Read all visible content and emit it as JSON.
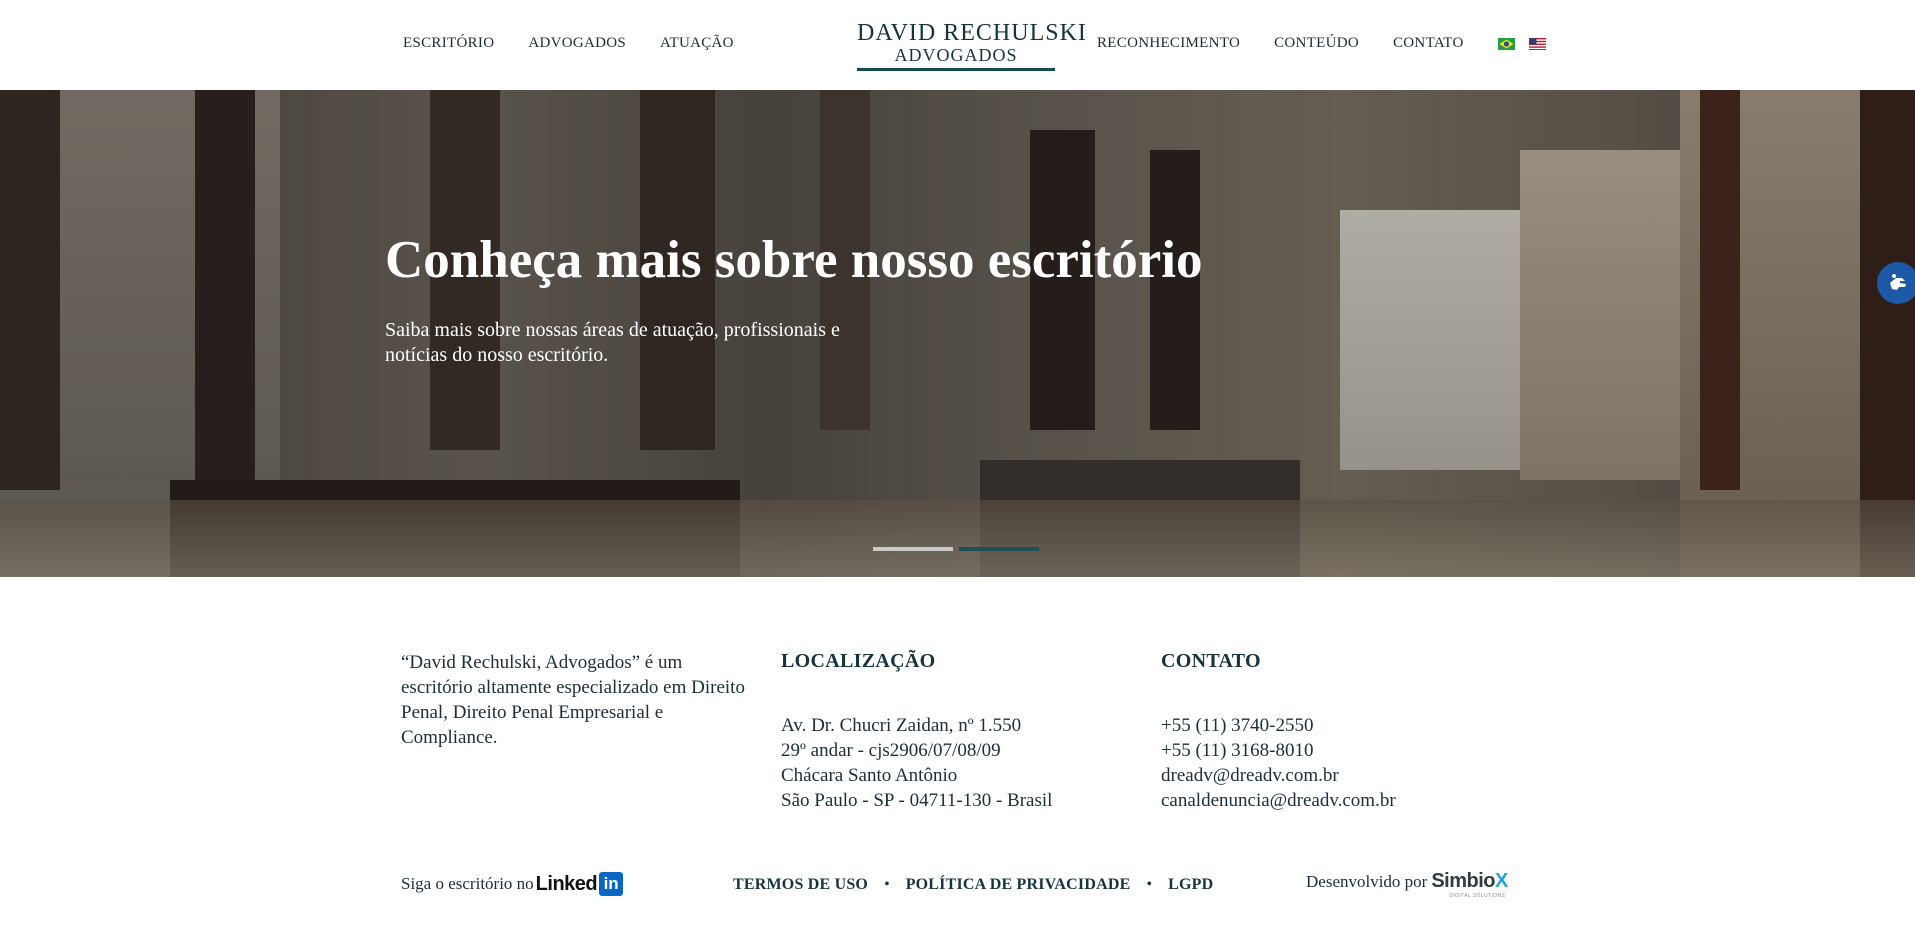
{
  "header": {
    "nav_left": [
      "ESCRITÓRIO",
      "ADVOGADOS",
      "ATUAÇÃO"
    ],
    "nav_right": [
      "RECONHECIMENTO",
      "CONTEÚDO",
      "CONTATO"
    ],
    "logo": {
      "line1": "DAVID RECHULSKI",
      "line2": "ADVOGADOS"
    },
    "flags": [
      "brazil-flag-icon",
      "usa-flag-icon"
    ]
  },
  "hero": {
    "title": "Conheça mais sobre nosso escritório",
    "subtitle": "Saiba mais sobre nossas áreas de atuação, profissionais e notícias do nosso escritório.",
    "slides": 2,
    "active_slide": 1
  },
  "footer": {
    "about": "“David Rechulski, Advogados” é um escritório altamente especializado em Direito Penal, Direito Penal Empresarial e Compliance.",
    "location": {
      "title": "LOCALIZAÇÃO",
      "lines": [
        "Av. Dr. Chucri Zaidan, nº 1.550",
        "29º andar - cjs2906/07/08/09",
        "Chácara Santo Antônio",
        "São Paulo - SP - 04711-130 - Brasil"
      ]
    },
    "contact": {
      "title": "CONTATO",
      "lines": [
        "+55 (11) 3740-2550",
        "+55 (11) 3168-8010",
        "dreadv@dreadv.com.br",
        "canaldenuncia@dreadv.com.br"
      ]
    },
    "follow": {
      "text": "Siga o escritório no",
      "brand": "Linked",
      "brand_box": "in"
    },
    "legal": [
      "TERMOS DE USO",
      "POLÍTICA DE PRIVACIDADE",
      "LGPD"
    ],
    "legal_separator": "•",
    "developer": {
      "text": "Desenvolvido por",
      "brand_main": "Simbio",
      "brand_x": "X",
      "tagline": "DIGITAL SOLUTIONS"
    }
  },
  "colors": {
    "brand": "#123440",
    "accent": "#164a52",
    "linkedin": "#0a66c2",
    "accessibility": "#1c5aa8"
  }
}
